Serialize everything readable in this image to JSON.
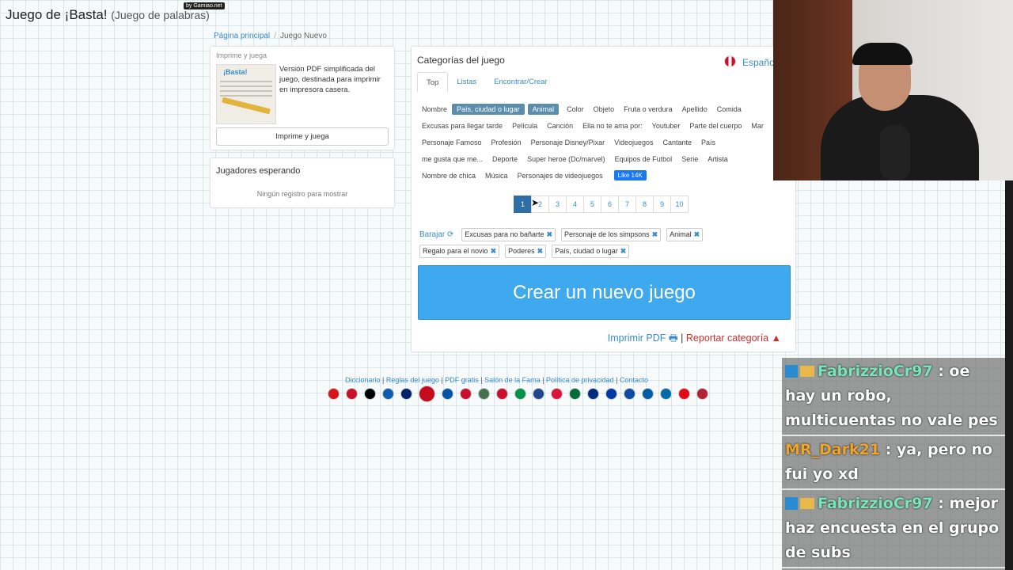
{
  "header": {
    "title": "Juego de ¡Basta!",
    "subtitle": "(Juego de palabras)",
    "badge": "by Gamiao.net"
  },
  "breadcrumb": {
    "home": "Página principal",
    "current": "Juego Nuevo"
  },
  "print_panel": {
    "heading": "Imprime y juega",
    "description": "Versión PDF simplificada del juego, destinada para imprimir en impresora casera.",
    "button": "Imprime y juega"
  },
  "waiting_panel": {
    "title": "Jugadores esperando",
    "empty": "Ningún registro para mostrar"
  },
  "categories": {
    "title": "Categorías del juego",
    "language": "Españo",
    "tabs": [
      "Top",
      "Listas",
      "Encontrar/Crear"
    ],
    "lines": [
      [
        {
          "label": "Nombre",
          "selected": false
        },
        {
          "label": "País, ciudad o lugar",
          "selected": true
        },
        {
          "label": "Animal",
          "selected": true
        },
        {
          "label": "Color",
          "selected": false
        },
        {
          "label": "Objeto",
          "selected": false
        },
        {
          "label": "Fruta o verdura",
          "selected": false
        },
        {
          "label": "Apellido",
          "selected": false
        },
        {
          "label": "Comida",
          "selected": false
        }
      ],
      [
        {
          "label": "Excusas para llegar tarde",
          "selected": false
        },
        {
          "label": "Película",
          "selected": false
        },
        {
          "label": "Canción",
          "selected": false
        },
        {
          "label": "Ella no te ama por:",
          "selected": false
        },
        {
          "label": "Youtuber",
          "selected": false
        },
        {
          "label": "Parte del cuerpo",
          "selected": false
        },
        {
          "label": "Mar",
          "selected": false
        }
      ],
      [
        {
          "label": "Personaje Famoso",
          "selected": false
        },
        {
          "label": "Profesión",
          "selected": false
        },
        {
          "label": "Personaje Disney/Pixar",
          "selected": false
        },
        {
          "label": "Videojuegos",
          "selected": false
        },
        {
          "label": "Cantante",
          "selected": false
        },
        {
          "label": "País",
          "selected": false
        }
      ],
      [
        {
          "label": "me gusta que me...",
          "selected": false
        },
        {
          "label": "Deporte",
          "selected": false
        },
        {
          "label": "Super heroe (Dc/marvel)",
          "selected": false
        },
        {
          "label": "Equipos de Futbol",
          "selected": false
        },
        {
          "label": "Serie",
          "selected": false
        },
        {
          "label": "Artista",
          "selected": false
        }
      ],
      [
        {
          "label": "Nombre de chica",
          "selected": false
        },
        {
          "label": "Música",
          "selected": false
        },
        {
          "label": "Personajes de videojuegos",
          "selected": false
        }
      ]
    ],
    "fb_like": "Like 14K",
    "pages": [
      "1",
      "2",
      "3",
      "4",
      "5",
      "6",
      "7",
      "8",
      "9",
      "10"
    ],
    "active_page": "1",
    "shuffle": "Barajar",
    "chosen_line1": [
      "Excusas para no bañarte",
      "Personaje de los simpsons",
      "Animal"
    ],
    "chosen_line2": [
      "Regalo para el novio",
      "Poderes",
      "País, ciudad o lugar"
    ],
    "create_button": "Crear un nuevo juego",
    "print_pdf": "Imprimir PDF",
    "separator": "|",
    "report": "Reportar categoría"
  },
  "footer": {
    "links": [
      "Diccionario",
      "Reglas del juego",
      "PDF gratis",
      "Salón de la Fama",
      "Política de privacidad",
      "Contacto"
    ],
    "flag_colors": [
      "#d7141a",
      "#c8102e",
      "#000000",
      "#0d5eaf",
      "#012169",
      "#c60b1e",
      "#0055a4",
      "#c8102e",
      "#477050",
      "#c8102e",
      "#009246",
      "#21468b",
      "#dc143c",
      "#046a38",
      "#002b7f",
      "#0039a6",
      "#0b4ea2",
      "#005da4",
      "#006aa7",
      "#e30a17",
      "#b22234"
    ]
  },
  "chat": [
    {
      "user": "FabrizzioCr97",
      "text": " : oe hay un robo, multicuentas no vale pes",
      "color": "#79e6ba"
    },
    {
      "user": "MR_Dark21",
      "text": " : ya, pero no fui yo xd",
      "color": "#f0a52a"
    },
    {
      "user": "FabrizzioCr97",
      "text": " : mejor haz encuesta en el grupo de subs",
      "color": "#79e6ba"
    }
  ]
}
